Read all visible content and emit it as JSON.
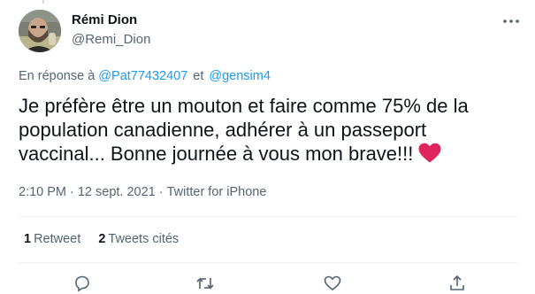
{
  "author": {
    "name": "Rémi Dion",
    "handle": "@Remi_Dion"
  },
  "reply": {
    "prefix": "En réponse à",
    "mentions": [
      "@Pat77432407",
      "@gensim4"
    ],
    "joiner": "et"
  },
  "tweet": {
    "text": "Je préfère être un mouton et faire comme 75% de la population canadienne, adhérer à un passeport vaccinal... Bonne journée à vous mon brave!!!",
    "emoji": "red-heart"
  },
  "meta": {
    "time": "2:10 PM",
    "separator": "·",
    "date": "12 sept. 2021",
    "source": "Twitter for iPhone"
  },
  "stats": {
    "retweets_count": "1",
    "retweets_label": "Retweet",
    "quotes_count": "2",
    "quotes_label": "Tweets cités"
  },
  "colors": {
    "accent": "#1d9bf0",
    "heart": "#e0245e",
    "secondary_text": "#536471",
    "divider": "#eff3f4"
  },
  "icons": {
    "more": "more-horizontal-icon",
    "reply": "reply-icon",
    "retweet": "retweet-icon",
    "like": "like-icon",
    "share": "share-icon"
  }
}
